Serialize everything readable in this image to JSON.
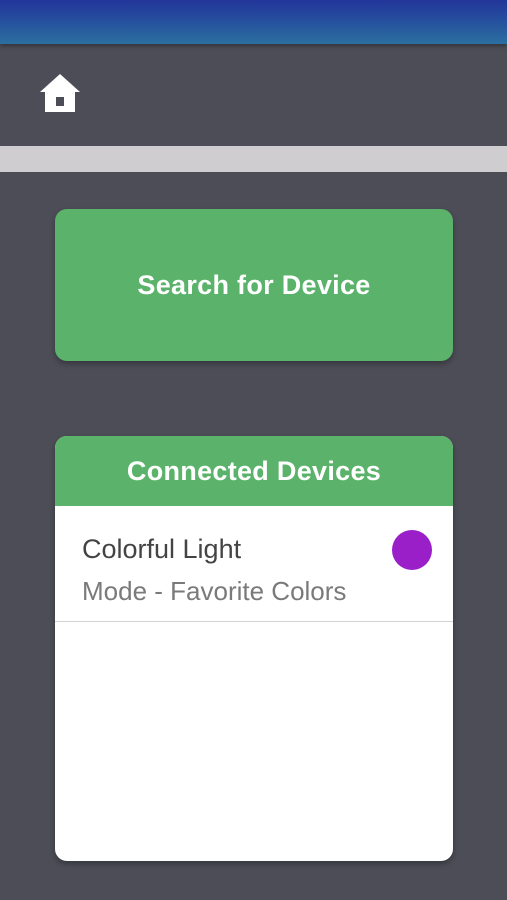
{
  "theme": {
    "accent": "#5bb36b",
    "background": "#4d4d57"
  },
  "header": {
    "home_icon": "home-icon"
  },
  "search": {
    "button_label": "Search for Device"
  },
  "connected_devices": {
    "title": "Connected Devices",
    "items": [
      {
        "name": "Colorful Light",
        "mode": "Mode - Favorite Colors",
        "color": "#9a1fc9"
      }
    ]
  }
}
